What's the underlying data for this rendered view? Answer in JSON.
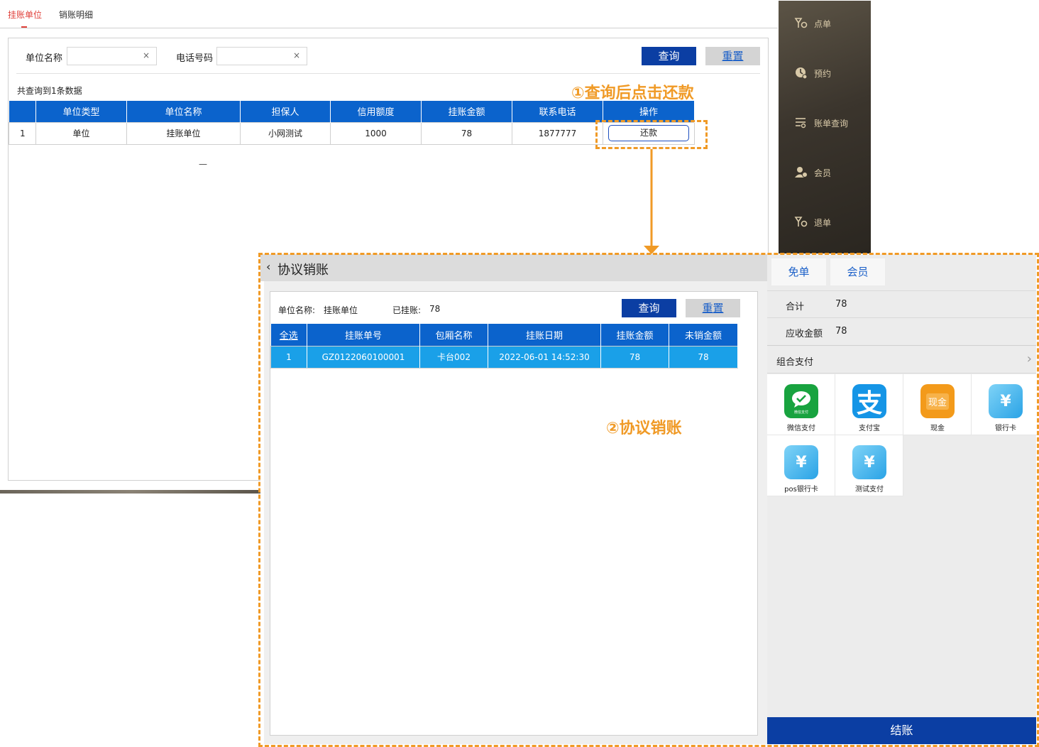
{
  "tabs": [
    "挂账单位",
    "销账明细"
  ],
  "search": {
    "unit_name_label": "单位名称",
    "phone_label": "电话号码",
    "unit_name_value": "",
    "phone_value": "",
    "clear_glyph": "×",
    "query_label": "查询",
    "reset_label": "重置",
    "result_count": "共查询到1条数据"
  },
  "units_table": {
    "headers": [
      "",
      "单位类型",
      "单位名称",
      "担保人",
      "信用额度",
      "挂账金额",
      "联系电话",
      "操作"
    ],
    "rows": [
      {
        "index": "1",
        "type": "单位",
        "name": "挂账单位",
        "guarantor": "小网测试",
        "credit": "1000",
        "amount": "78",
        "phone": "1877777",
        "action": "还款"
      }
    ],
    "dash": "—"
  },
  "side_menu": [
    {
      "label": "点单",
      "icon": "order-icon"
    },
    {
      "label": "预约",
      "icon": "reservation-icon"
    },
    {
      "label": "账单查询",
      "icon": "bill-query-icon"
    },
    {
      "label": "会员",
      "icon": "member-icon"
    },
    {
      "label": "退单",
      "icon": "refund-icon"
    }
  ],
  "annotations": {
    "step1": "①查询后点击还款",
    "step2": "②协议销账"
  },
  "dialog": {
    "title": "协议销账",
    "unit_label": "单位名称:",
    "unit_value": "挂账单位",
    "charged_label": "已挂账:",
    "charged_value": "78",
    "query_label": "查询",
    "reset_label": "重置",
    "table": {
      "headers": [
        "全选",
        "挂账单号",
        "包厢名称",
        "挂账日期",
        "挂账金额",
        "未销金额"
      ],
      "rows": [
        {
          "index": "1",
          "order_no": "GZ0122060100001",
          "room": "卡台002",
          "date": "2022-06-01 14:52:30",
          "amount": "78",
          "unsettled": "78"
        }
      ]
    }
  },
  "payment": {
    "free_label": "免单",
    "member_label": "会员",
    "total_label": "合计",
    "total_value": "78",
    "receivable_label": "应收金额",
    "receivable_value": "78",
    "combo_label": "组合支付",
    "methods": [
      {
        "label": "微信支付",
        "icon": "wechat-pay-icon",
        "badge": "微信支付"
      },
      {
        "label": "支付宝",
        "icon": "alipay-icon",
        "badge": "支"
      },
      {
        "label": "现金",
        "icon": "cash-icon",
        "badge": "现金"
      },
      {
        "label": "银行卡",
        "icon": "bank-card-icon",
        "badge": "¥"
      },
      {
        "label": "pos银行卡",
        "icon": "pos-card-icon",
        "badge": "¥"
      },
      {
        "label": "测试支付",
        "icon": "test-pay-icon",
        "badge": "¥"
      }
    ],
    "checkout_label": "结账"
  },
  "colors": {
    "accent_blue": "#0b3ea3",
    "header_blue": "#0b63cc",
    "row_selected": "#1aa0e8",
    "annotation_orange": "#f09a26",
    "tab_active_red": "#e0413b"
  }
}
